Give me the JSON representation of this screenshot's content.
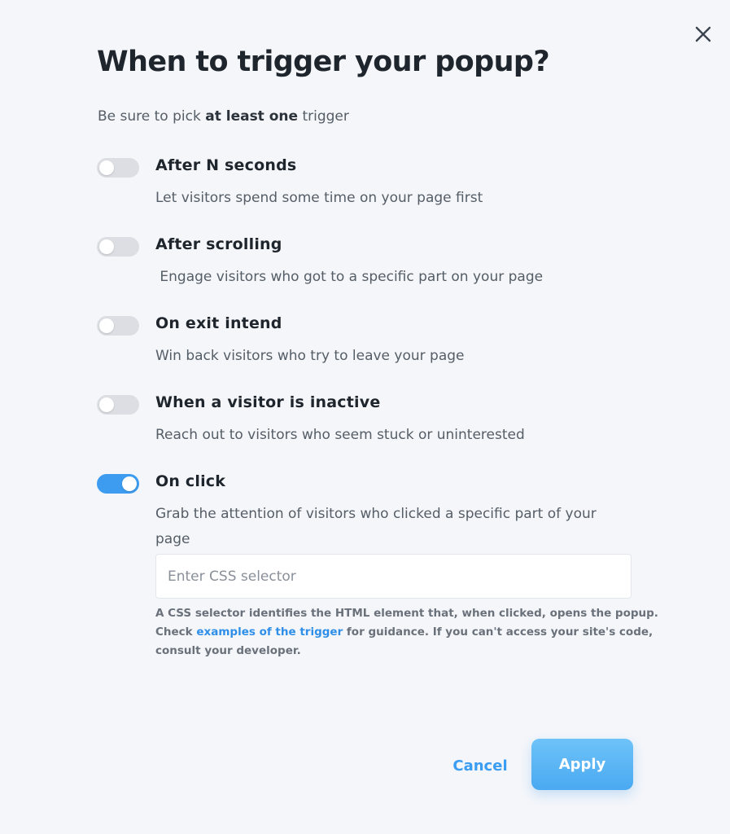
{
  "dialog": {
    "title": "When to trigger your popup?",
    "subtitle_prefix": "Be sure to pick ",
    "subtitle_bold": "at least one",
    "subtitle_suffix": " trigger"
  },
  "triggers": [
    {
      "label": "After N seconds",
      "description": "Let visitors spend some time on your page first",
      "enabled": false
    },
    {
      "label": "After scrolling",
      "description": " Engage visitors who got to a specific part on your page",
      "enabled": false
    },
    {
      "label": "On exit intend",
      "description": "Win back visitors who try to leave your page",
      "enabled": false
    },
    {
      "label": "When a visitor is inactive",
      "description": "Reach out to visitors who seem stuck or uninterested",
      "enabled": false
    },
    {
      "label": "On click",
      "description": "Grab the attention of visitors who clicked a specific part of your page",
      "enabled": true
    }
  ],
  "css_selector": {
    "value": "",
    "placeholder": "Enter CSS selector"
  },
  "hint": {
    "part1": "A CSS selector identifies the HTML element that, when clicked, opens the popup. Check ",
    "link": "examples of the trigger",
    "part2": " for guidance.  If you can't access your site's code, consult your developer."
  },
  "actions": {
    "cancel_label": "Cancel",
    "apply_label": "Apply"
  },
  "colors": {
    "accent": "#3d9cf0",
    "toggle_off": "#dcdee3",
    "background": "#f4f6fa"
  },
  "icons": {
    "close": "close-icon"
  }
}
